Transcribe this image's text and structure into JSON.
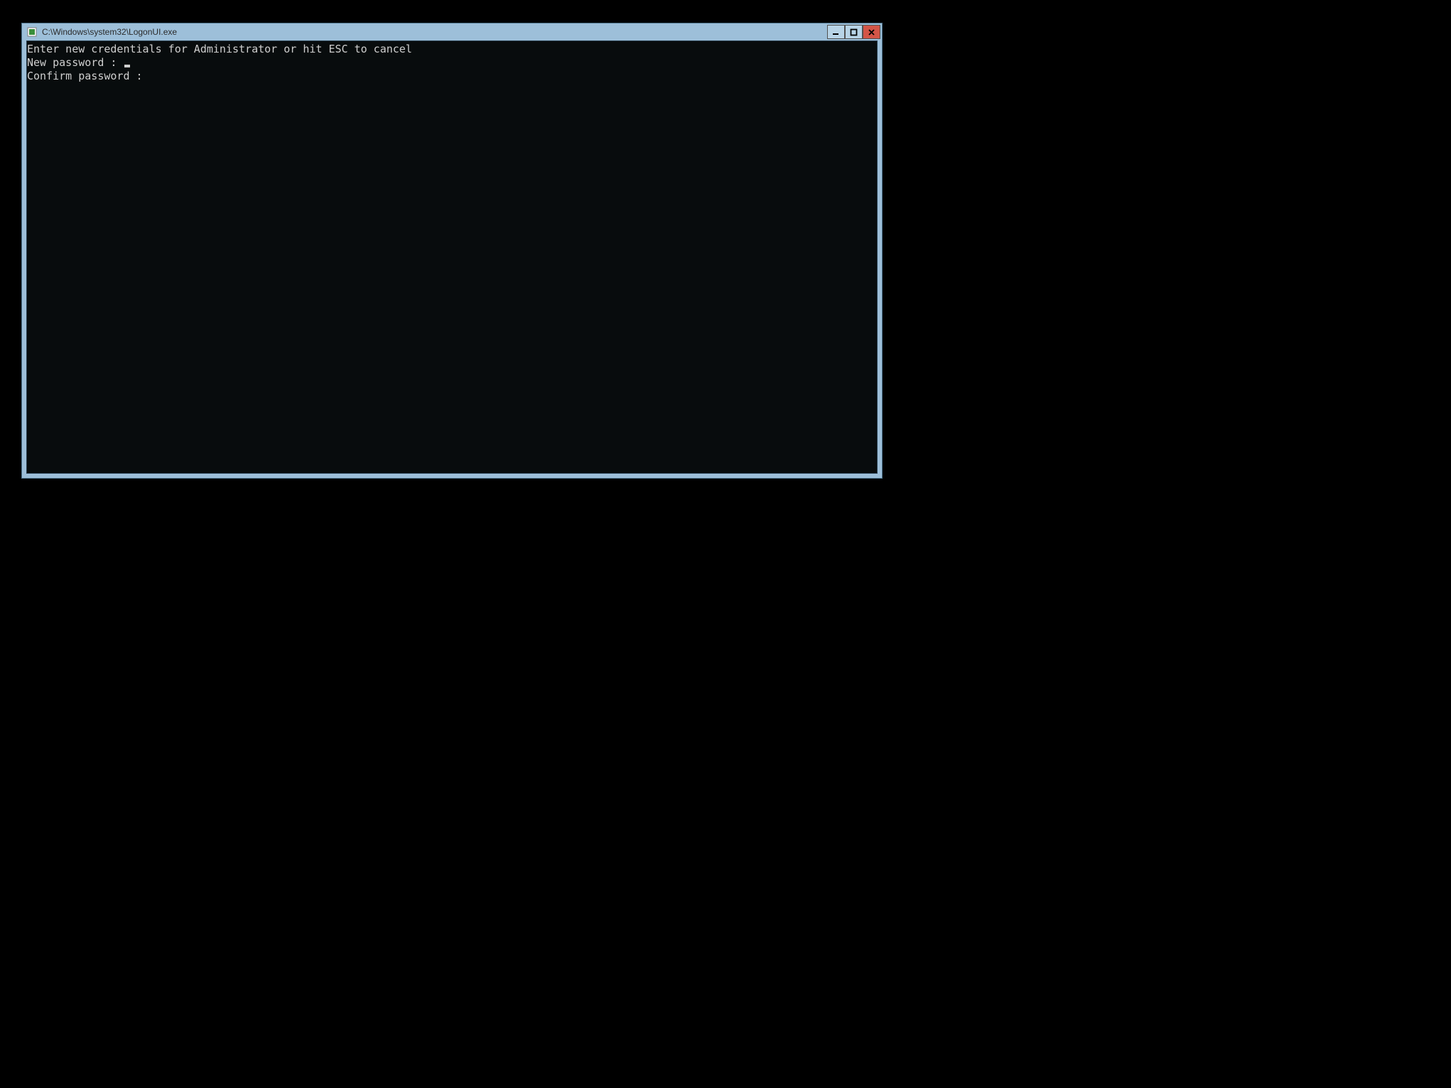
{
  "window": {
    "title": "C:\\Windows\\system32\\LogonUI.exe"
  },
  "console": {
    "line1": "Enter new credentials for Administrator or hit ESC to cancel",
    "line2_label": "New password : ",
    "line3_label": "Confirm password :"
  }
}
